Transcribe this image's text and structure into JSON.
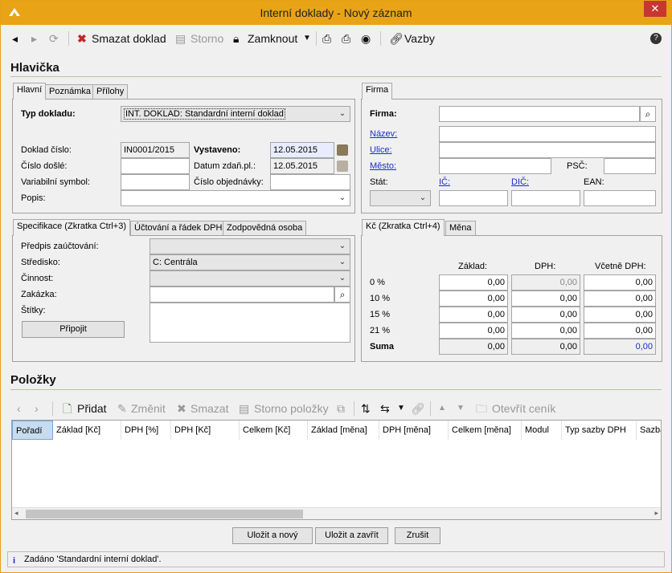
{
  "window": {
    "title": "Interní doklady - Nový záznam",
    "close": "✕"
  },
  "toolbar": {
    "delete": "Smazat doklad",
    "cancel": "Storno",
    "lock": "Zamknout",
    "links": "Vazby",
    "help": "?"
  },
  "header": {
    "title": "Hlavička"
  },
  "tabs_main": [
    "Hlavní",
    "Poznámka",
    "Přílohy"
  ],
  "main": {
    "doc_type_label": "Typ dokladu:",
    "doc_type_value": "INT. DOKLAD: Standardní interní doklad",
    "doc_num_label": "Doklad číslo:",
    "doc_num_value": "IN0001/2015",
    "issued_label": "Vystaveno:",
    "issued_value": "12.05.2015",
    "recv_label": "Číslo došlé:",
    "tax_date_label": "Datum zdaň.pl.:",
    "tax_date_value": "12.05.2015",
    "var_label": "Variabilní symbol:",
    "order_label": "Číslo objednávky:",
    "desc_label": "Popis:"
  },
  "firm_tab": "Firma",
  "firm": {
    "firm_label": "Firma:",
    "name_label": "Název:",
    "street_label": "Ulice:",
    "city_label": "Město:",
    "zip_label": "PSČ:",
    "state_label": "Stát:",
    "ic_label": "IČ:",
    "dic_label": "DIČ:",
    "ean_label": "EAN:"
  },
  "tabs_spec": [
    "Specifikace (Zkratka Ctrl+3)",
    "Účtování a řádek DPH",
    "Zodpovědná osoba"
  ],
  "spec": {
    "prescript_label": "Předpis zaúčtování:",
    "center_label": "Středisko:",
    "center_value": "C: Centrála",
    "activity_label": "Činnost:",
    "job_label": "Zakázka:",
    "tags_label": "Štítky:",
    "attach_btn": "Připojit"
  },
  "tabs_vat": [
    "Kč (Zkratka Ctrl+4)",
    "Měna"
  ],
  "vat": {
    "cols": [
      "Základ:",
      "DPH:",
      "Včetně DPH:"
    ],
    "rows": [
      {
        "label": "0 %",
        "base": "0,00",
        "vat": "0,00",
        "total": "0,00"
      },
      {
        "label": "10 %",
        "base": "0,00",
        "vat": "0,00",
        "total": "0,00"
      },
      {
        "label": "15 %",
        "base": "0,00",
        "vat": "0,00",
        "total": "0,00"
      },
      {
        "label": "21 %",
        "base": "0,00",
        "vat": "0,00",
        "total": "0,00"
      },
      {
        "label": "Suma",
        "base": "0,00",
        "vat": "0,00",
        "total": "0,00"
      }
    ]
  },
  "items": {
    "title": "Položky",
    "add": "Přidat",
    "edit": "Změnit",
    "delete": "Smazat",
    "storno": "Storno položky",
    "pricelist": "Otevřít ceník",
    "columns": [
      "Pořadí",
      "Základ [Kč]",
      "DPH [%]",
      "DPH [Kč]",
      "Celkem [Kč]",
      "Základ [měna]",
      "DPH [měna]",
      "Celkem [měna]",
      "Modul",
      "Typ sazby DPH",
      "Sazba"
    ]
  },
  "buttons": {
    "save_new": "Uložit a nový",
    "save_close": "Uložit a zavřít",
    "cancel": "Zrušit"
  },
  "status": {
    "text": "Zadáno 'Standardní interní doklad'."
  }
}
